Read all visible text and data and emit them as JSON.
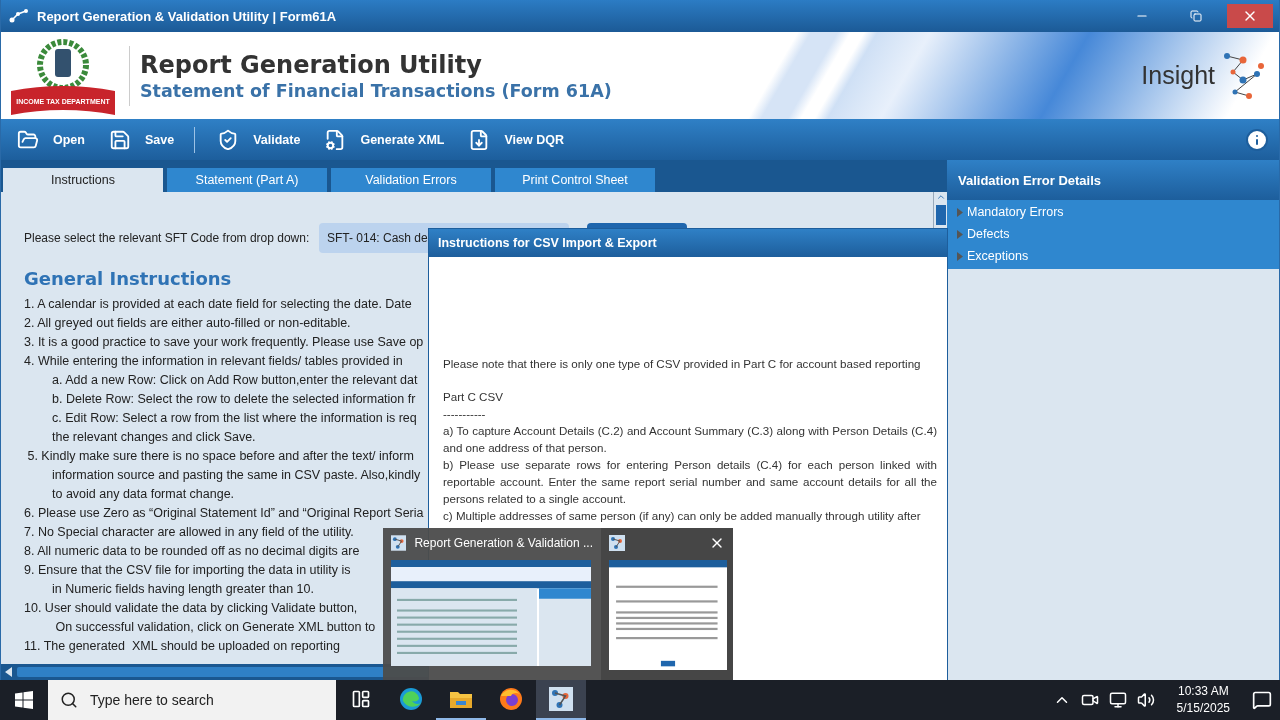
{
  "window": {
    "title": "Report Generation & Validation Utility | Form61A"
  },
  "header": {
    "title": "Report Generation Utility",
    "subtitle": "Statement of Financial Transactions (Form 61A)",
    "logo_text": "INCOME TAX DEPARTMENT",
    "brand": "Insight"
  },
  "toolbar": [
    {
      "label": "Open",
      "kind": "open"
    },
    {
      "label": "Save",
      "kind": "save"
    },
    {
      "label": "Validate",
      "kind": "validate"
    },
    {
      "label": "Generate XML",
      "kind": "xml"
    },
    {
      "label": "View DQR",
      "kind": "dqr"
    }
  ],
  "tabs": [
    {
      "label": "Instructions",
      "selected": true
    },
    {
      "label": "Statement (Part A)",
      "selected": false
    },
    {
      "label": "Validation Errors",
      "selected": false
    },
    {
      "label": "Print Control Sheet",
      "selected": false
    }
  ],
  "sft": {
    "label": "Please select the relevant SFT Code from drop down:",
    "value": "SFT- 014: Cash de"
  },
  "instructions": {
    "heading": "General Instructions",
    "lines": [
      {
        "kind": "item",
        "text": "1. A calendar is provided at each date field for selecting the date. Date"
      },
      {
        "kind": "item",
        "text": "2. All greyed out fields are either auto-filled or non-editable."
      },
      {
        "kind": "item",
        "text": "3. It is a good practice to save your work frequently. Please use Save op"
      },
      {
        "kind": "item",
        "text": "4. While entering the information in relevant fields/ tables provided in"
      },
      {
        "kind": "sub",
        "text": "a. Add a new Row: Click on Add Row button,enter the relevant dat"
      },
      {
        "kind": "sub",
        "text": "b. Delete Row: Select the row to delete the selected information fr"
      },
      {
        "kind": "sub",
        "text": "c. Edit Row: Select a row from the list where the information is req"
      },
      {
        "kind": "sub",
        "text": "the relevant changes and click Save."
      },
      {
        "kind": "item",
        "text": " 5. Kindly make sure there is no space before and after the text/ inform"
      },
      {
        "kind": "sub",
        "text": "information source and pasting the same in CSV paste. Also,kindly"
      },
      {
        "kind": "sub",
        "text": "to avoid any data format change."
      },
      {
        "kind": "item",
        "text": "6. Please use Zero as “Original Statement Id” and “Original Report Seria"
      },
      {
        "kind": "item",
        "text": "7. No Special character are allowed in any field of the utility."
      },
      {
        "kind": "item",
        "text": "8. All numeric data to be rounded off as no decimal digits are"
      },
      {
        "kind": "item",
        "text": "9. Ensure that the CSV file for importing the data in utility is"
      },
      {
        "kind": "sub",
        "text": "in Numeric fields having length greater than 10."
      },
      {
        "kind": "item",
        "text": "10. User should validate the data by clicking Validate button,"
      },
      {
        "kind": "sub",
        "text": " On successful validation, click on Generate XML button to"
      },
      {
        "kind": "item",
        "text": "11. The generated  XML should be uploaded on reporting"
      }
    ]
  },
  "side_panel": {
    "title": "Validation Error Details",
    "items": [
      {
        "label": "Mandatory Errors",
        "expanded": false
      },
      {
        "label": "Defects",
        "expanded": false
      },
      {
        "label": "Exceptions",
        "expanded": false
      }
    ]
  },
  "dialog": {
    "title": "Instructions for CSV Import & Export",
    "paragraphs": [
      {
        "kind": "note",
        "text": "Please note that there is only one type of CSV provided in Part C for account based reporting"
      },
      {
        "kind": "heading",
        "text": "Part C CSV"
      },
      {
        "kind": "rule",
        "text": "-----------"
      },
      {
        "kind": "body",
        "text": "a) To capture Account Details (C.2) and Account Summary (C.3) along with Person Details (C.4) and one address of that person."
      },
      {
        "kind": "body",
        "text": "b) Please use separate rows for entering Person details (C.4) for each person linked with reportable account. Enter the same report serial number and same account details for all the persons related to a single account."
      },
      {
        "kind": "body",
        "text": "c) Multiple addresses of same person (if any) can only be added manually through utility after"
      }
    ]
  },
  "preview": {
    "title": "Report Generation & Validation ..."
  },
  "taskbar": {
    "search_placeholder": "Type here to search",
    "apps": [
      {
        "kind": "taskview",
        "running": false,
        "selected": false
      },
      {
        "kind": "edge",
        "running": false,
        "selected": false
      },
      {
        "kind": "explorer",
        "running": true,
        "selected": false
      },
      {
        "kind": "firefox",
        "running": false,
        "selected": false
      },
      {
        "kind": "utility",
        "running": true,
        "selected": true
      }
    ],
    "time": "10:33 AM",
    "date": "5/15/2025"
  }
}
